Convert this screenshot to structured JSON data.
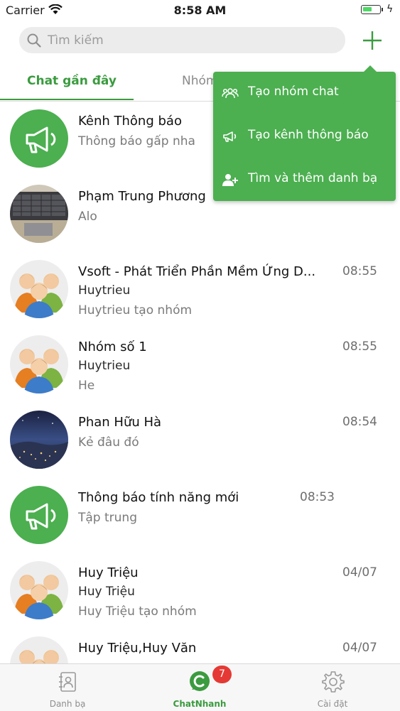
{
  "status_bar": {
    "carrier": "Carrier",
    "time": "8:58 AM"
  },
  "search": {
    "placeholder": "Tìm kiếm",
    "value": ""
  },
  "tabs": [
    {
      "label": "Chat gần đây",
      "active": true
    },
    {
      "label": "Nhóm",
      "active": false
    }
  ],
  "menu": {
    "items": [
      {
        "label": "Tạo nhóm chat",
        "icon": "group-icon"
      },
      {
        "label": "Tạo kênh thông báo",
        "icon": "megaphone-icon"
      },
      {
        "label": "Tìm và thêm danh bạ",
        "icon": "add-contact-icon"
      }
    ]
  },
  "chats": [
    {
      "name": "Kênh Thông báo",
      "sender": "",
      "message": "Thông báo gấp nha",
      "time": "",
      "avatar": "megaphone-avatar"
    },
    {
      "name": "Phạm Trung Phương",
      "sender": "",
      "message": "Alo",
      "time": "",
      "avatar": "photo-laptop-avatar"
    },
    {
      "name": "Vsoft - Phát Triển Phần Mềm Ứng D...",
      "sender": "Huytrieu",
      "message": "Huytrieu tạo nhóm",
      "time": "08:55",
      "avatar": "group-avatar"
    },
    {
      "name": "Nhóm số 1",
      "sender": "Huytrieu",
      "message": "He",
      "time": "08:55",
      "avatar": "group-avatar"
    },
    {
      "name": "Phan Hữu Hà",
      "sender": "",
      "message": "Kẻ đâu đó",
      "time": "08:54",
      "avatar": "photo-night-avatar"
    },
    {
      "name": "Thông báo tính năng mới",
      "sender": "",
      "message": "Tập trung",
      "time": "08:53",
      "avatar": "megaphone-avatar"
    },
    {
      "name": "Huy Triệu",
      "sender": "Huy Triệu",
      "message": "Huy Triệu tạo nhóm",
      "time": "04/07",
      "avatar": "group-avatar"
    },
    {
      "name": "Huy Triệu,Huy Văn",
      "sender": "",
      "message": "",
      "time": "04/07",
      "avatar": "group-avatar"
    }
  ],
  "bottom_tabs": [
    {
      "label": "Danh bạ",
      "icon": "contacts-icon",
      "active": false
    },
    {
      "label": "ChatNhanh",
      "icon": "chat-icon",
      "active": true,
      "badge": "7"
    },
    {
      "label": "Cài đặt",
      "icon": "gear-icon",
      "active": false
    }
  ],
  "colors": {
    "accent": "#3b9b3f",
    "menu_bg": "#4caf50",
    "badge": "#e53935"
  }
}
